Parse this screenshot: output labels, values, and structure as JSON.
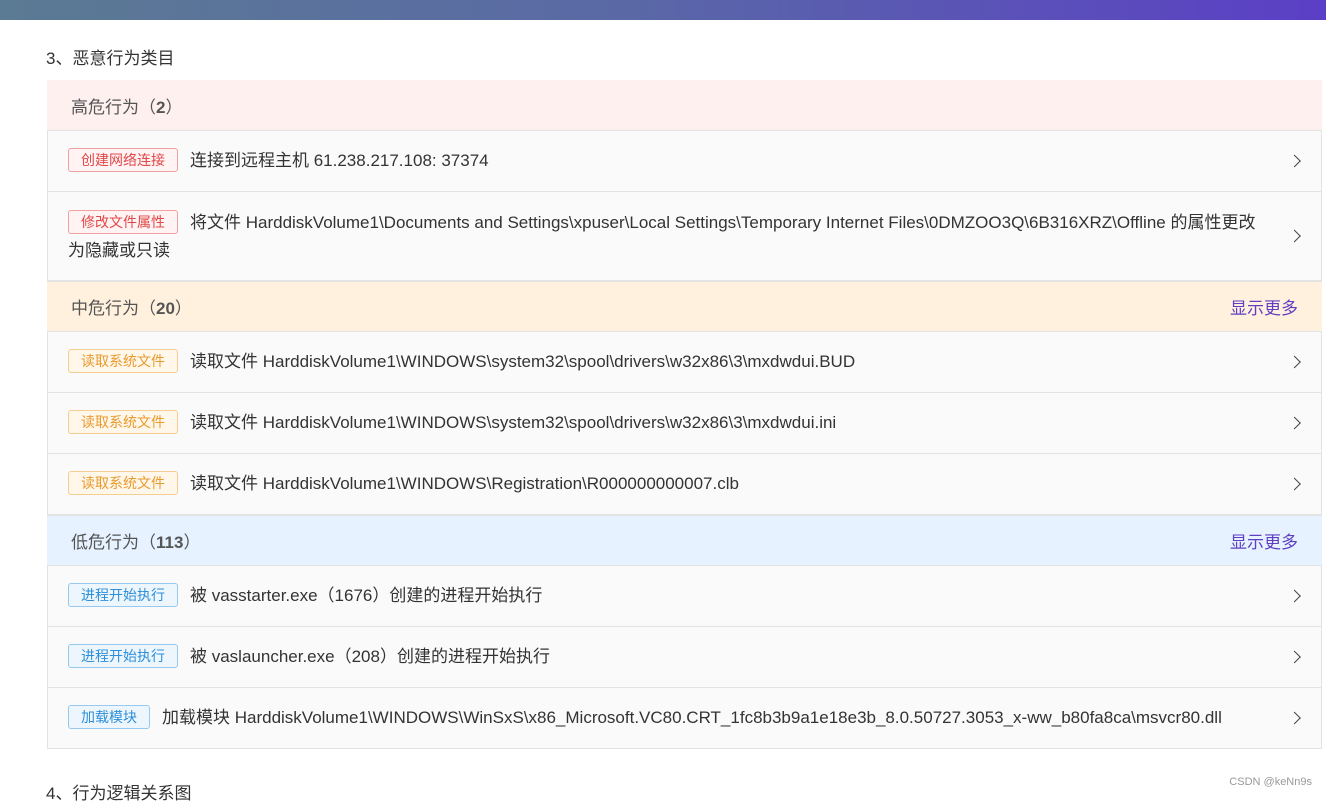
{
  "section3_title": "3、恶意行为类目",
  "section4_title": "4、行为逻辑关系图",
  "groups": {
    "high": {
      "label": "高危行为（",
      "count": "2",
      "close": "）",
      "items": [
        {
          "tag": "创建网络连接",
          "text": "连接到远程主机 61.238.217.108: 37374"
        },
        {
          "tag": "修改文件属性",
          "text": "将文件 HarddiskVolume1\\Documents and Settings\\xpuser\\Local Settings\\Temporary Internet Files\\0DMZOO3Q\\6B316XRZ\\Offline 的属性更改为隐藏或只读"
        }
      ]
    },
    "mid": {
      "label": "中危行为（",
      "count": "20",
      "close": "）",
      "show_more": "显示更多",
      "items": [
        {
          "tag": "读取系统文件",
          "text": "读取文件 HarddiskVolume1\\WINDOWS\\system32\\spool\\drivers\\w32x86\\3\\mxdwdui.BUD"
        },
        {
          "tag": "读取系统文件",
          "text": "读取文件 HarddiskVolume1\\WINDOWS\\system32\\spool\\drivers\\w32x86\\3\\mxdwdui.ini"
        },
        {
          "tag": "读取系统文件",
          "text": "读取文件 HarddiskVolume1\\WINDOWS\\Registration\\R000000000007.clb"
        }
      ]
    },
    "low": {
      "label": "低危行为（",
      "count": "113",
      "close": "）",
      "show_more": "显示更多",
      "items": [
        {
          "tag": "进程开始执行",
          "text": "被 vasstarter.exe（1676）创建的进程开始执行"
        },
        {
          "tag": "进程开始执行",
          "text": "被 vaslauncher.exe（208）创建的进程开始执行"
        },
        {
          "tag": "加载模块",
          "text": "加载模块 HarddiskVolume1\\WINDOWS\\WinSxS\\x86_Microsoft.VC80.CRT_1fc8b3b9a1e18e3b_8.0.50727.3053_x-ww_b80fa8ca\\msvcr80.dll"
        }
      ]
    }
  },
  "colors": {
    "high_bg": "#fff0f0",
    "mid_bg": "#fff1de",
    "low_bg": "#e6f2ff",
    "show_more": "#5e3fc4",
    "tag_red": "#e04848",
    "tag_orange": "#e99a2d",
    "tag_blue": "#2d8fd8"
  },
  "icons": {
    "row_arrow": "chevron-right-icon"
  },
  "watermark": "CSDN @keNn9s"
}
